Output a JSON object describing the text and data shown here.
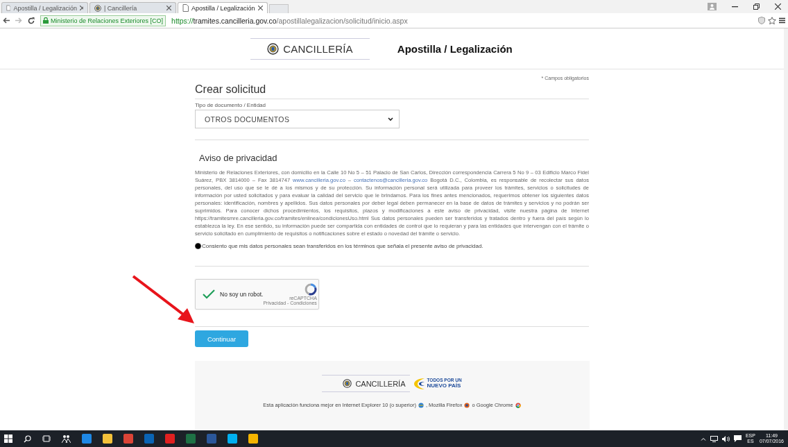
{
  "browser": {
    "tabs": [
      {
        "label": "Apostilla / Legalización",
        "selected": false,
        "kind": "page"
      },
      {
        "label": "| Cancillería",
        "selected": false,
        "kind": "seal"
      },
      {
        "label": "Apostilla / Legalización",
        "selected": true,
        "kind": "page"
      }
    ],
    "site_identity": "Ministerio de Relaciones Exteriores [CO]",
    "url_scheme": "https://",
    "url_host": "tramites.cancilleria.gov.co",
    "url_path": "/apostillalegalizacion/solicitud/inicio.aspx"
  },
  "header": {
    "logo": "CANCILLERÍA",
    "title": "Apostilla / Legalización"
  },
  "form": {
    "required_note": "* Campos obligatorios",
    "heading": "Crear solicitud",
    "field_label": "Tipo de documento / Entidad",
    "field_value": "OTROS DOCUMENTOS",
    "privacy_title": "Aviso de privacidad",
    "privacy_text": [
      {
        "kind": "text",
        "text": "Ministerio de Relaciones Exteriores, con domicilio en la Calle 10 No 5 – 51 Palacio de San Carlos, Dirección correspondencia Carrera 5 No 9 – 03 Edificio Marco Fidel Suárez, PBX 3814000 – Fax 3814747 "
      },
      {
        "kind": "link",
        "text": "www.cancilleria.gov.co"
      },
      {
        "kind": "text",
        "text": " – "
      },
      {
        "kind": "link",
        "text": "contactenos@cancilleria.gov.co"
      },
      {
        "kind": "text",
        "text": " Bogotá D.C., Colombia, es responsable de recolectar sus datos personales, del uso que se le dé a los mismos y de su protección. Su información personal será utilizada para proveer los trámites, servicios o solicitudes de información por usted solicitados y para evaluar la calidad del servicio que le brindamos. Para los fines antes mencionados, requerimos obtener los siguientes datos personales: identificación, nombres y apellidos. Sus datos personales por deber legal deben permanecer en la base de datos de trámites y servicios y no podrán ser suprimidos. Para conocer dichos procedimientos, los requisitos, plazos y modificaciones a este aviso de privacidad, visite nuestra página de Internet https://tramitesmre.cancilleria.gov.co/tramites/enlinea/condicionesUso.html Sus datos personales pueden ser transferidos y tratados dentro y fuera del país según lo establezca la ley. En ese sentido, su información puede ser compartida con entidades de control que lo requieran y para las entidades que intervengan con el trámite o servicio solicitado en cumplimiento de requisitos o notificaciones sobre el estado o novedad del trámite o servicio."
      }
    ],
    "consent": {
      "label": "Consiento que mis datos personales sean transferidos en los términos que señala el presente aviso de privacidad.",
      "checked": true
    },
    "captcha": {
      "label": "No soy un robot.",
      "checked": true,
      "brand": "reCAPTCHA",
      "links": "Privacidad - Condiciones"
    },
    "submit": "Continuar"
  },
  "footer": {
    "logo": "CANCILLERÍA",
    "slogan_top": "TODOS POR UN",
    "slogan_bottom": "NUEVO PAÍS",
    "browsers_note": "Esta aplicación funciona mejor en Internet Explorer 10 (o superior)",
    "note_sep_1": ", Mozilla Firefox",
    "note_sep_2": "o Google Chrome"
  },
  "taskbar": {
    "language_top": "ESP",
    "language_bottom": "ES",
    "time": "11:49",
    "date": "07/07/2016"
  }
}
